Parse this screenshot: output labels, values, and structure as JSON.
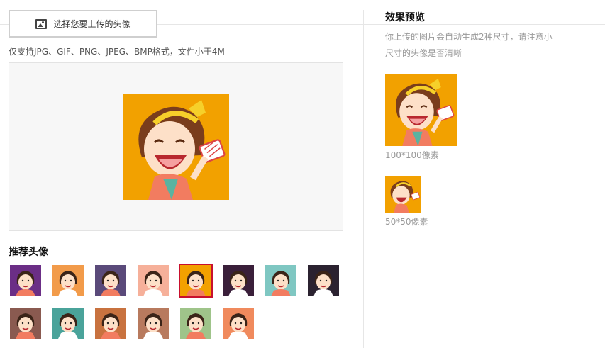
{
  "upload": {
    "button_label": "选择您要上传的头像",
    "icon": "image-icon",
    "hint": "仅支持JPG、GIF、PNG、JPEG、BMP格式，文件小于4M"
  },
  "recommend": {
    "title": "推荐头像",
    "avatars": [
      {
        "name": "avatar-girl-crown",
        "bg": "#6b2e86"
      },
      {
        "name": "avatar-girl-headband-red",
        "bg": "#f29b4a"
      },
      {
        "name": "avatar-girl-long-hair",
        "bg": "#5a4a7a"
      },
      {
        "name": "avatar-girl-peach",
        "bg": "#f6b09a"
      },
      {
        "name": "avatar-girl-yellow-bow",
        "bg": "#f2a100"
      },
      {
        "name": "avatar-girl-dark",
        "bg": "#3a1f3a"
      },
      {
        "name": "avatar-girl-teal",
        "bg": "#7fc7c2"
      },
      {
        "name": "avatar-man-sunglasses",
        "bg": "#2b2230"
      },
      {
        "name": "avatar-man-bowtie",
        "bg": "#8a5a50"
      },
      {
        "name": "avatar-man-glasses-teal",
        "bg": "#4aa39a"
      },
      {
        "name": "avatar-man-sunglasses-orange",
        "bg": "#c8723f"
      },
      {
        "name": "avatar-old-man-beard",
        "bg": "#b87a5e"
      },
      {
        "name": "avatar-boy-cap",
        "bg": "#9fc48a"
      },
      {
        "name": "avatar-man-orange",
        "bg": "#f08a5d"
      }
    ],
    "selected_index": 4
  },
  "preview": {
    "title": "效果预览",
    "description": "你上传的图片会自动生成2种尺寸，请注意小尺寸的头像是否清晰",
    "label_100": "100*100像素",
    "label_50": "50*50像素"
  }
}
